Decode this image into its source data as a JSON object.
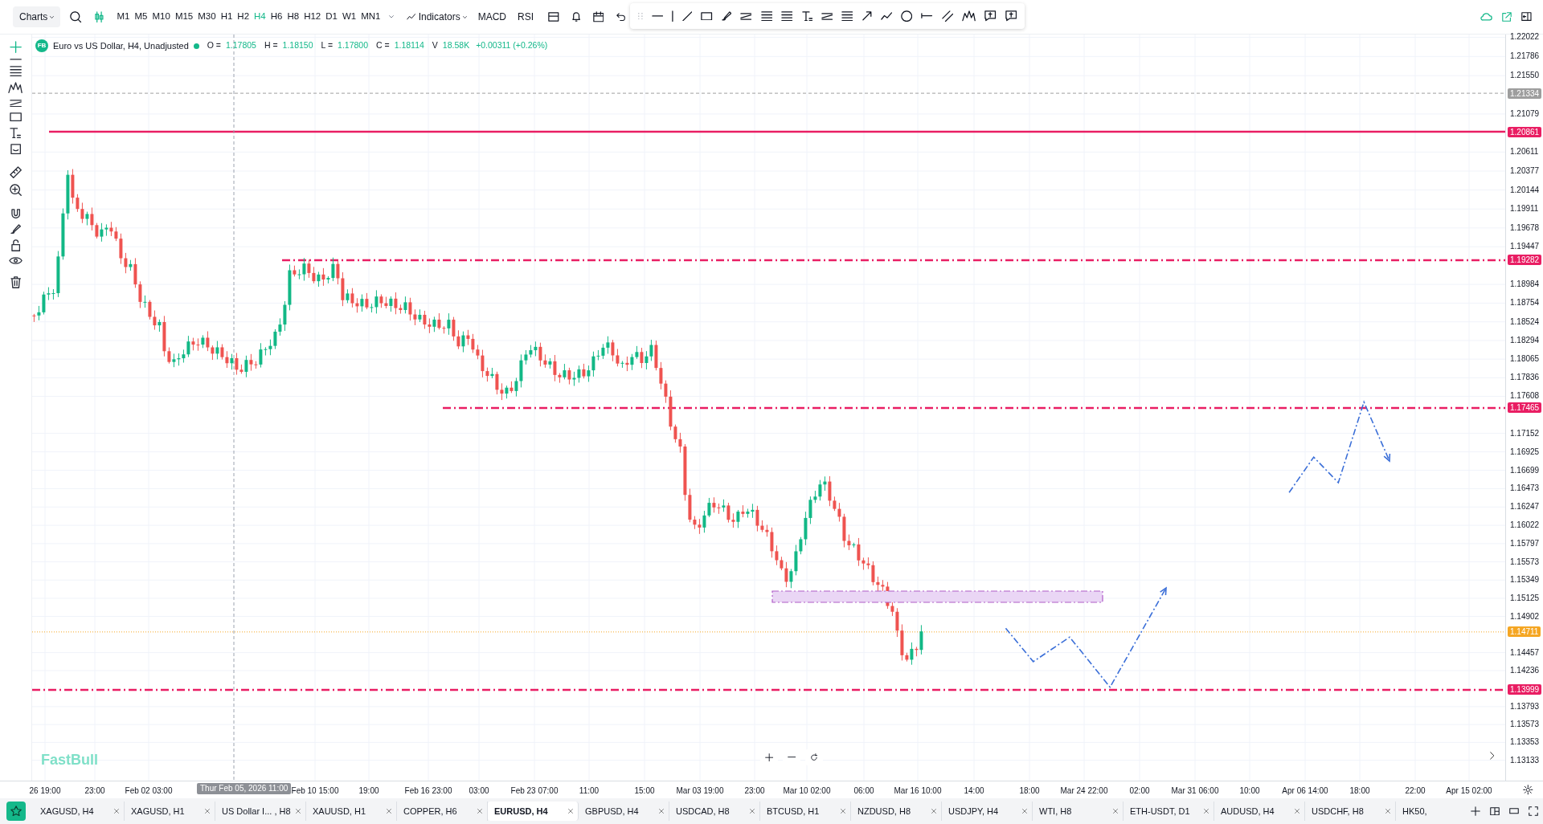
{
  "toolbar": {
    "charts_menu": "Charts",
    "timeframes": [
      {
        "label": "M1",
        "selected": false
      },
      {
        "label": "M5",
        "selected": false
      },
      {
        "label": "M10",
        "selected": false
      },
      {
        "label": "M15",
        "selected": false
      },
      {
        "label": "M30",
        "selected": false
      },
      {
        "label": "H1",
        "selected": false
      },
      {
        "label": "H2",
        "selected": false
      },
      {
        "label": "H4",
        "selected": true
      },
      {
        "label": "H6",
        "selected": false
      },
      {
        "label": "H8",
        "selected": false
      },
      {
        "label": "H12",
        "selected": false
      },
      {
        "label": "D1",
        "selected": false
      },
      {
        "label": "W1",
        "selected": false
      },
      {
        "label": "MN1",
        "selected": false
      }
    ],
    "indicators": "Indicators",
    "studies": [
      "MACD",
      "RSI"
    ]
  },
  "legend": {
    "badge": "FB",
    "title": "Euro vs US Dollar, H4, Unadjusted",
    "values": [
      {
        "label": "O =",
        "value": "1.17805"
      },
      {
        "label": "H =",
        "value": "1.18150"
      },
      {
        "label": "L =",
        "value": "1.17800"
      },
      {
        "label": "C =",
        "value": "1.18114"
      },
      {
        "label": "V",
        "value": "18.58K"
      }
    ],
    "change": "+0.00311 (+0.26%)"
  },
  "price_axis": [
    "1.22022",
    "1.21786",
    "1.21550",
    "1.21079",
    "1.20611",
    "1.20377",
    "1.20144",
    "1.19911",
    "1.19678",
    "1.19447",
    "1.18984",
    "1.18754",
    "1.18524",
    "1.18294",
    "1.18065",
    "1.17836",
    "1.17608",
    "1.17152",
    "1.16925",
    "1.16699",
    "1.16473",
    "1.16247",
    "1.16022",
    "1.15797",
    "1.15573",
    "1.15349",
    "1.15125",
    "1.14902",
    "1.14457",
    "1.14236",
    "1.13793",
    "1.13573",
    "1.13353",
    "1.13133"
  ],
  "price_lines": [
    {
      "label": "1.21334",
      "kind": "dashed",
      "color": "#9e9e9e"
    },
    {
      "label": "1.20861",
      "kind": "solid",
      "color": "#e91e63"
    },
    {
      "label": "1.19282",
      "kind": "dashdot",
      "color": "#e91e63"
    },
    {
      "label": "1.17465",
      "kind": "dashdot",
      "color": "#e91e63"
    },
    {
      "label": "1.14711",
      "kind": "dotted",
      "color": "#f5a623"
    },
    {
      "label": "1.13999",
      "kind": "dashdot",
      "color": "#e91e63"
    }
  ],
  "watermark_logo": "FastBull",
  "time_axis": [
    "26 19:00",
    "23:00",
    "Feb 02 03:00",
    "Feb 10 15:00",
    "19:00",
    "Feb 16 23:00",
    "03:00",
    "Feb 23 07:00",
    "11:00",
    "15:00",
    "Mar 03 19:00",
    "23:00",
    "Mar 10 02:00",
    "06:00",
    "Mar 16 10:00",
    "14:00",
    "18:00",
    "Mar 24 22:00",
    "02:00",
    "Mar 31 06:00",
    "10:00",
    "Apr 06 14:00",
    "18:00",
    "22:00",
    "Apr 15 02:00"
  ],
  "crosshair_time": "Thur Feb 05, 2026 11:00",
  "tabs": [
    {
      "label": "XAGUSD, H4",
      "selected": false,
      "closable": true
    },
    {
      "label": "XAGUSD, H1",
      "selected": false,
      "closable": true
    },
    {
      "label": "US Dollar I... , H8",
      "selected": false,
      "closable": true
    },
    {
      "label": "XAUUSD, H1",
      "selected": false,
      "closable": true
    },
    {
      "label": "COPPER, H6",
      "selected": false,
      "closable": true
    },
    {
      "label": "EURUSD, H4",
      "selected": true,
      "closable": true
    },
    {
      "label": "GBPUSD, H4",
      "selected": false,
      "closable": true
    },
    {
      "label": "USDCAD, H8",
      "selected": false,
      "closable": true
    },
    {
      "label": "BTCUSD, H1",
      "selected": false,
      "closable": true
    },
    {
      "label": "NZDUSD, H8",
      "selected": false,
      "closable": true
    },
    {
      "label": "USDJPY, H4",
      "selected": false,
      "closable": true
    },
    {
      "label": "WTI, H8",
      "selected": false,
      "closable": true
    },
    {
      "label": "ETH-USDT, D1",
      "selected": false,
      "closable": true
    },
    {
      "label": "AUDUSD, H4",
      "selected": false,
      "closable": true
    },
    {
      "label": "USDCHF, H8",
      "selected": false,
      "closable": true
    },
    {
      "label": "HK50,",
      "selected": false,
      "closable": false
    }
  ]
}
